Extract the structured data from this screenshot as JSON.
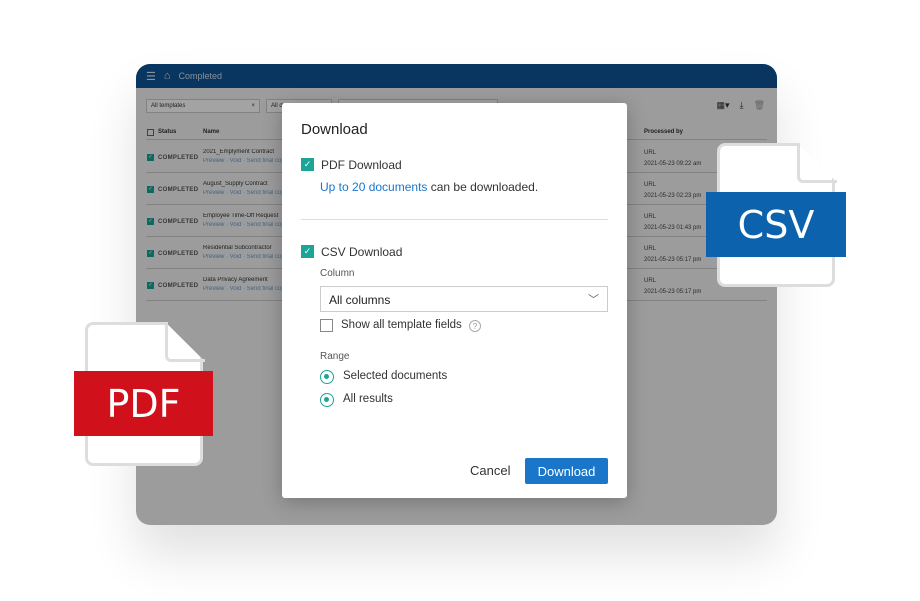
{
  "header": {
    "title": "Completed",
    "menu_icon": "hamburger-icon",
    "home_icon": "home-icon"
  },
  "filters": {
    "template": "All templates",
    "second": "All d"
  },
  "table": {
    "columns": {
      "status": "Status",
      "name": "Name",
      "processed": "Processed by"
    },
    "rows": [
      {
        "status": "COMPLETED",
        "name": "2021_Emplyment Contract",
        "actions": "Preview · Void · Send final copy",
        "processed_by": "URL",
        "date": "2021-05-23 09:22 am"
      },
      {
        "status": "COMPLETED",
        "name": "August_Supply Contract",
        "actions": "Preview · Void · Send final copy",
        "processed_by": "URL",
        "date": "2021-05-23 02:23 pm"
      },
      {
        "status": "COMPLETED",
        "name": "Employee Time-Off Request",
        "actions": "Preview · Void · Send final copy",
        "processed_by": "URL",
        "date": "2021-05-23 01:43 pm"
      },
      {
        "status": "COMPLETED",
        "name": "Residential Subcontractor",
        "actions": "Preview · Void · Send final copy",
        "processed_by": "URL",
        "date": "2021-05-23 05:17 pm"
      },
      {
        "status": "COMPLETED",
        "name": "Data Privacy Agreement",
        "actions": "Preview · Void · Send final copy",
        "processed_by": "URL",
        "date": "2021-05-23 05:17 pm"
      }
    ]
  },
  "dialog": {
    "title": "Download",
    "pdf_label": "PDF Download",
    "pdf_note_link": "Up to 20 documents",
    "pdf_note_rest": " can be downloaded.",
    "csv_label": "CSV Download",
    "column_label": "Column",
    "column_value": "All columns",
    "show_fields": "Show all template fields",
    "range_label": "Range",
    "range_options": [
      "Selected documents",
      "All results"
    ],
    "cancel": "Cancel",
    "download": "Download"
  },
  "badges": {
    "csv": "CSV",
    "pdf": "PDF",
    "csv_color": "#0d62ad",
    "pdf_color": "#d0111b"
  }
}
